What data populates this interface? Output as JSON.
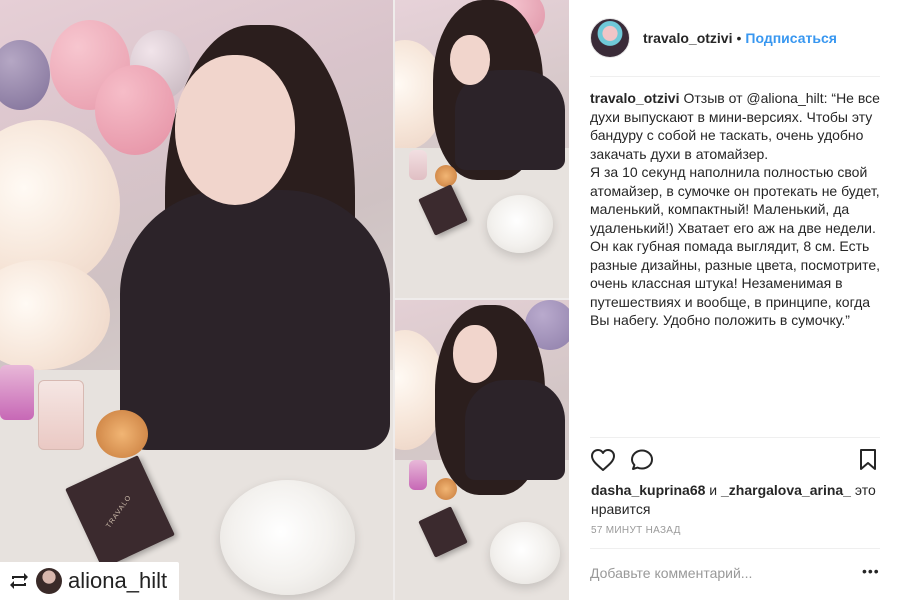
{
  "post": {
    "username": "travalo_otzivi",
    "separator": "•",
    "follow_label": "Подписаться",
    "caption": "Отзыв от @aliona_hilt: “Не все духи выпускают в мини-версиях. Чтобы эту бандуру с собой не таскать, очень удобно закачать духи в атомайзер.\nЯ за 10 секунд наполнила полностью свой атомайзер, в сумочке он протекать не будет, маленький, компактный! Маленький, да удаленький!) Хватает его аж на две недели. Он как губная помада выглядит, 8 см. Есть разные дизайны, разные цвета, посмотрите, очень классная штука! Незаменимая в путешествиях и вообще, в принципе, когда Вы набегу. Удобно положить в сумочку.”",
    "likers": {
      "first": "dasha_kuprina68",
      "conjunction": "и",
      "second": "_zhargalova_arina_",
      "suffix": "это нравится"
    },
    "time_ago": "57 МИНУТ НАЗАД",
    "comment_placeholder": "Добавьте комментарий...",
    "more_label": "•••"
  },
  "image": {
    "repost_username": "aliona_hilt",
    "box_brand": "TRAVALO"
  },
  "icons": {
    "like": "heart-icon",
    "comment": "comment-icon",
    "save": "bookmark-icon",
    "repost": "repost-icon"
  },
  "colors": {
    "link": "#3897f0",
    "text": "#262626",
    "muted": "#999999"
  }
}
